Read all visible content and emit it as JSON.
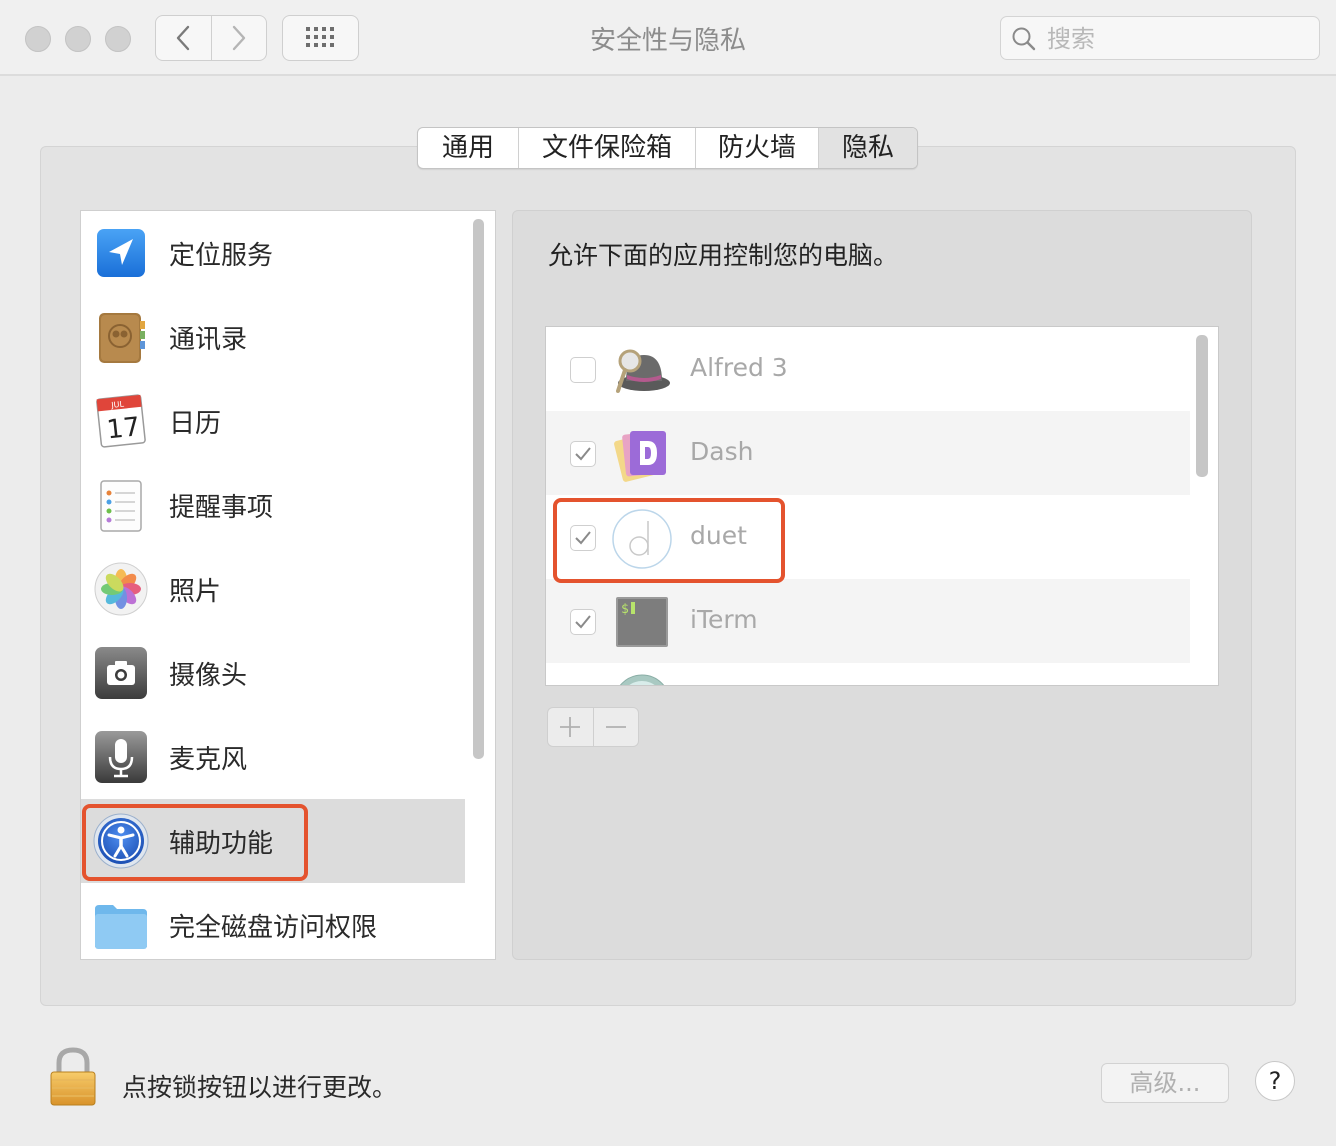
{
  "window": {
    "title": "安全性与隐私",
    "search_placeholder": "搜索"
  },
  "tabs": [
    {
      "label": "通用",
      "active": false
    },
    {
      "label": "文件保险箱",
      "active": false
    },
    {
      "label": "防火墙",
      "active": false
    },
    {
      "label": "隐私",
      "active": true
    }
  ],
  "sidebar": {
    "items": [
      {
        "label": "定位服务",
        "icon": "location-arrow-icon"
      },
      {
        "label": "通讯录",
        "icon": "contacts-book-icon"
      },
      {
        "label": "日历",
        "icon": "calendar-icon",
        "month": "JUL",
        "day": "17"
      },
      {
        "label": "提醒事项",
        "icon": "reminders-icon"
      },
      {
        "label": "照片",
        "icon": "photos-icon"
      },
      {
        "label": "摄像头",
        "icon": "camera-icon"
      },
      {
        "label": "麦克风",
        "icon": "microphone-icon"
      },
      {
        "label": "辅助功能",
        "icon": "accessibility-icon",
        "selected": true
      },
      {
        "label": "完全磁盘访问权限",
        "icon": "folder-icon"
      }
    ]
  },
  "main": {
    "description": "允许下面的应用控制您的电脑。",
    "apps": [
      {
        "name": "Alfred 3",
        "checked": false,
        "icon": "alfred-hat-icon"
      },
      {
        "name": "Dash",
        "checked": true,
        "icon": "dash-icon"
      },
      {
        "name": "duet",
        "checked": true,
        "icon": "duet-icon"
      },
      {
        "name": "iTerm",
        "checked": true,
        "icon": "iterm-icon",
        "icon_text": "$"
      }
    ],
    "add_label": "+",
    "remove_label": "−"
  },
  "footer": {
    "lock_text": "点按锁按钮以进行更改。",
    "advanced_label": "高级...",
    "help_label": "?"
  },
  "colors": {
    "highlight": "#e4532e",
    "selected_row": "#dcdcdc",
    "window_bg": "#ececec"
  }
}
